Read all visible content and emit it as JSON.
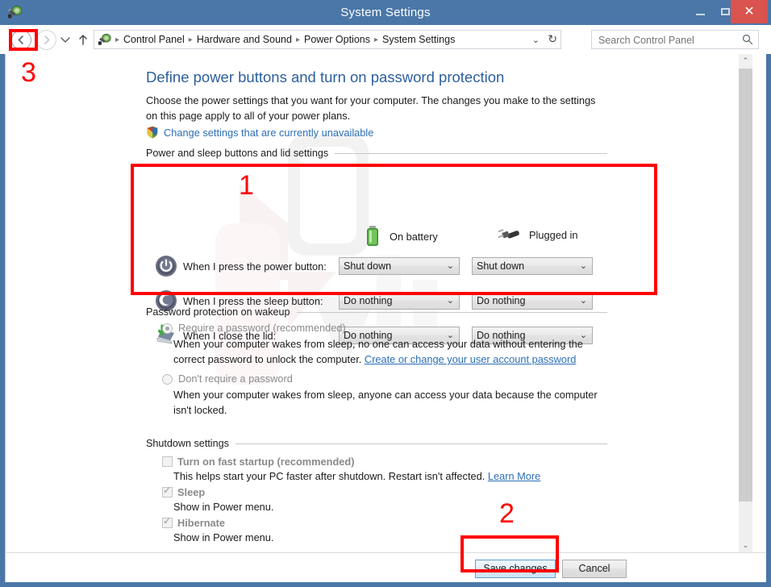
{
  "window": {
    "title": "System Settings",
    "app_icon": "power-plug-icon",
    "minimize_label": "Minimize",
    "maximize_label": "Maximize",
    "close_label": "Close",
    "titlebar_color": "#4A77A8",
    "close_button_color": "#D9534F"
  },
  "toolbar": {
    "back_label": "Back",
    "forward_label": "Forward",
    "recent_label": "Recent locations",
    "up_label": "Up one level",
    "breadcrumb": [
      "Control Panel",
      "Hardware and Sound",
      "Power Options",
      "System Settings"
    ],
    "breadcrumb_separator": "▸",
    "dropdown_glyph": "⌄",
    "refresh_glyph": "↻",
    "search": {
      "placeholder": "Search Control Panel",
      "value": ""
    }
  },
  "page": {
    "title": "Define power buttons and turn on password protection",
    "description": "Choose the power settings that you want for your computer. The changes you make to the settings on this page apply to all of your power plans.",
    "unavailable_link": "Change settings that are currently unavailable",
    "link_color": "#2C6FB5",
    "title_color": "#2C5F9E"
  },
  "power_section": {
    "group_label": "Power and sleep buttons and lid settings",
    "columns": [
      {
        "icon": "battery-icon",
        "label": "On battery"
      },
      {
        "icon": "power-plug-icon",
        "label": "Plugged in"
      }
    ],
    "rows": [
      {
        "icon": "power-button-icon",
        "label": "When I press the power button:",
        "on_battery": "Shut down",
        "plugged_in": "Shut down"
      },
      {
        "icon": "sleep-button-icon",
        "label": "When I press the sleep button:",
        "on_battery": "Do nothing",
        "plugged_in": "Do nothing"
      },
      {
        "icon": "close-lid-icon",
        "label": "When I close the lid:",
        "on_battery": "Do nothing",
        "plugged_in": "Do nothing"
      }
    ],
    "dropdown_arrow": "⌄"
  },
  "password_section": {
    "group_label": "Password protection on wakeup",
    "options": [
      {
        "label": "Require a password (recommended)",
        "checked": true,
        "description_before": "When your computer wakes from sleep, no one can access your data without entering the correct password to unlock the computer. ",
        "link": "Create or change your user account password",
        "description_after": ""
      },
      {
        "label": "Don't require a password",
        "checked": false,
        "description_before": "When your computer wakes from sleep, anyone can access your data because the computer isn't locked.",
        "link": "",
        "description_after": ""
      }
    ]
  },
  "shutdown_section": {
    "group_label": "Shutdown settings",
    "items": [
      {
        "label": "Turn on fast startup (recommended)",
        "checked": false,
        "description_before": "This helps start your PC faster after shutdown. Restart isn't affected. ",
        "link": "Learn More"
      },
      {
        "label": "Sleep",
        "checked": true,
        "description_before": "Show in Power menu.",
        "link": ""
      },
      {
        "label": "Hibernate",
        "checked": true,
        "description_before": "Show in Power menu.",
        "link": ""
      }
    ]
  },
  "footer": {
    "save_label": "Save changes",
    "cancel_label": "Cancel"
  },
  "scrollbar": {
    "up_glyph": "⌃",
    "down_glyph": "⌄"
  },
  "annotations": {
    "color": "#FF0000",
    "markers": [
      {
        "number": "1",
        "target": "power-and-sleep-settings-group"
      },
      {
        "number": "2",
        "target": "save-changes-button"
      },
      {
        "number": "3",
        "target": "back-button"
      }
    ]
  }
}
